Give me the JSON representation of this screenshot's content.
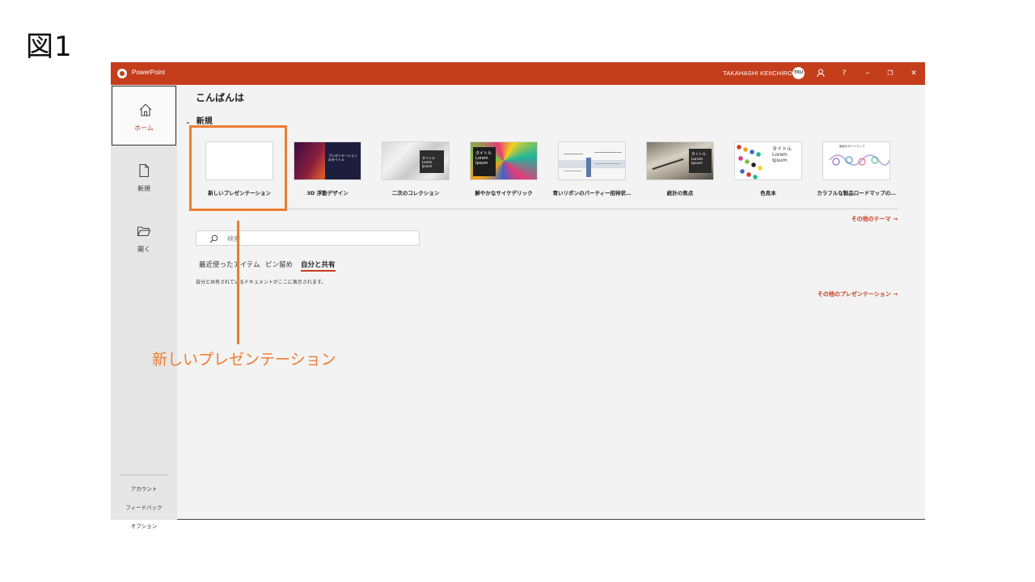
{
  "figure_label": "図1",
  "titlebar": {
    "app_name": "PowerPoint",
    "user_name": "TAKAHASHI KEIICHIRO",
    "avatar_initials": "TKU",
    "help": "?",
    "minimize": "–",
    "restore": "❐",
    "close": "✕"
  },
  "sidebar": {
    "items": [
      {
        "label": "ホーム",
        "icon": "home-icon"
      },
      {
        "label": "新規",
        "icon": "new-file-icon"
      },
      {
        "label": "開く",
        "icon": "folder-open-icon"
      }
    ],
    "bottom_links": [
      "アカウント",
      "フィードバック",
      "オプション"
    ]
  },
  "main": {
    "greeting": "こんばんは",
    "new_section": "新規",
    "templates": [
      "新しいプレゼンテーション",
      "3D 浮動デザイン",
      "二次のコレクション",
      "鮮やかなサイケデリック",
      "青いリボンのパーティー招待状…",
      "統計の焦点",
      "色見本",
      "カラフルな製品ロードマップの…"
    ],
    "thumb_text": {
      "t2": "プレゼンテーションのタイトル",
      "t3": "タイトル Lorem Ipsum",
      "t4": "タイトル Lorem Ipsum",
      "t6": "タイトル Lorem Ipsum",
      "t7": "タイトル Lorem Ipsum",
      "t8": "製品のロードマップ"
    },
    "more_themes": "その他のテーマ →",
    "search_placeholder": "検索",
    "tabs": [
      "最近使ったアイテム",
      "ピン留め",
      "自分と共有"
    ],
    "active_tab": "自分と共有",
    "empty_message": "自分と共有されているドキュメントがここに表示されます。",
    "more_presentations": "その他のプレゼンテーション →"
  },
  "annotation": {
    "callout": "新しいプレゼンテーション",
    "color": "#ed7d31"
  },
  "colors": {
    "accent": "#c43e1c",
    "highlight": "#ed7d31"
  }
}
